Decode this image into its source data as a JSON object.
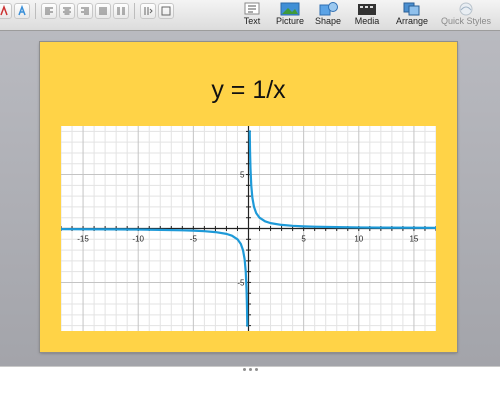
{
  "ribbon": {
    "items": [
      {
        "id": "text",
        "label": "Text",
        "icon": "text-box-icon"
      },
      {
        "id": "picture",
        "label": "Picture",
        "icon": "picture-icon"
      },
      {
        "id": "shape",
        "label": "Shape",
        "icon": "shape-icon"
      },
      {
        "id": "media",
        "label": "Media",
        "icon": "media-icon"
      },
      {
        "id": "arrange",
        "label": "Arrange",
        "icon": "arrange-icon"
      },
      {
        "id": "quick_styles",
        "label": "Quick Styles",
        "icon": "quick-styles-icon"
      }
    ]
  },
  "slide": {
    "title": "y = 1/x",
    "background_color": "#ffd347"
  },
  "chart_data": {
    "type": "line",
    "title": "",
    "xlabel": "",
    "ylabel": "",
    "xlim": [
      -17,
      17
    ],
    "ylim": [
      -9.5,
      9.5
    ],
    "grid": true,
    "x_ticks": [
      -15,
      -10,
      -5,
      5,
      10,
      15
    ],
    "y_ticks": [
      -5,
      5
    ],
    "series": [
      {
        "color": "#1e9ad8",
        "x": [
          -17,
          -15,
          -12,
          -10,
          -8,
          -6,
          -5,
          -4,
          -3,
          -2,
          -1.5,
          -1,
          -0.7,
          -0.5,
          -0.35,
          -0.25,
          -0.18,
          -0.14,
          -0.11
        ],
        "y": [
          -0.0588,
          -0.0667,
          -0.0833,
          -0.1,
          -0.125,
          -0.1667,
          -0.2,
          -0.25,
          -0.3333,
          -0.5,
          -0.6667,
          -1,
          -1.4286,
          -2,
          -2.8571,
          -4,
          -5.5556,
          -7.1429,
          -9.0909
        ]
      },
      {
        "color": "#1e9ad8",
        "x": [
          0.11,
          0.14,
          0.18,
          0.25,
          0.35,
          0.5,
          0.7,
          1,
          1.5,
          2,
          3,
          4,
          5,
          6,
          8,
          10,
          12,
          15,
          17
        ],
        "y": [
          9.0909,
          7.1429,
          5.5556,
          4,
          2.8571,
          2,
          1.4286,
          1,
          0.6667,
          0.5,
          0.3333,
          0.25,
          0.2,
          0.1667,
          0.125,
          0.1,
          0.0833,
          0.0667,
          0.0588
        ]
      }
    ]
  }
}
